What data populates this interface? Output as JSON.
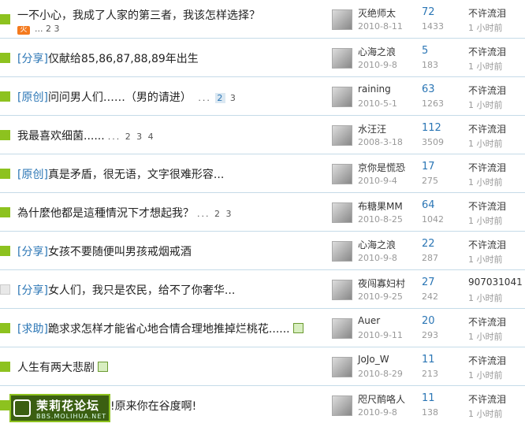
{
  "threads": [
    {
      "tag": "",
      "title": "一不小心，我成了人家的第三者，我该怎样选择？",
      "pages": "... 2 3",
      "pages_cur": "",
      "sub_fire": "火",
      "author": "灭绝师太",
      "date": "2010-8-11",
      "replies": "72",
      "views": "1433",
      "last_user": "不许流泪",
      "last_time": "1 小时前",
      "icon": "hot",
      "img": false
    },
    {
      "tag": "[分享]",
      "title": "仅献给85,86,87,88,89年出生",
      "pages": "",
      "pages_cur": "",
      "author": "心海之浪",
      "date": "2010-9-8",
      "replies": "5",
      "views": "183",
      "last_user": "不许流泪",
      "last_time": "1 小时前",
      "icon": "new",
      "img": false
    },
    {
      "tag": "[原创]",
      "title": "问问男人们……（男的请进）",
      "pages": "...",
      "pages_cur": "2",
      "pages_after": "3",
      "author": "raining",
      "date": "2010-5-1",
      "replies": "63",
      "views": "1263",
      "last_user": "不许流泪",
      "last_time": "1 小时前",
      "icon": "new",
      "img": false
    },
    {
      "tag": "",
      "title": "我最喜欢细菌......",
      "pages": "... 2 3 4",
      "pages_cur": "",
      "author": "水汪汪",
      "date": "2008-3-18",
      "replies": "112",
      "views": "3509",
      "last_user": "不许流泪",
      "last_time": "1 小时前",
      "icon": "new",
      "img": false
    },
    {
      "tag": "[原创]",
      "title": "真是矛盾，很无语，文字很难形容...",
      "pages": "",
      "pages_cur": "",
      "author": "京你是慌恐",
      "date": "2010-9-4",
      "replies": "17",
      "views": "275",
      "last_user": "不许流泪",
      "last_time": "1 小时前",
      "icon": "new",
      "img": false
    },
    {
      "tag": "",
      "title": "為什麼他都是這種情況下才想起我？",
      "pages": "... 2 3",
      "pages_cur": "",
      "author": "布糖果MM",
      "date": "2010-8-25",
      "replies": "64",
      "views": "1042",
      "last_user": "不许流泪",
      "last_time": "1 小时前",
      "icon": "new",
      "img": false
    },
    {
      "tag": "[分享]",
      "title": "女孩不要随便叫男孩戒烟戒酒",
      "pages": "",
      "pages_cur": "",
      "author": "心海之浪",
      "date": "2010-9-8",
      "replies": "22",
      "views": "287",
      "last_user": "不许流泪",
      "last_time": "1 小时前",
      "icon": "new",
      "img": false
    },
    {
      "tag": "[分享]",
      "title": "女人们，我只是农民，给不了你奢华...",
      "pages": "",
      "pages_cur": "",
      "author": "夜闯寡妇村",
      "date": "2010-9-25",
      "replies": "27",
      "views": "242",
      "last_user": "907031041",
      "last_time": "1 小时前",
      "icon": "plain",
      "img": false
    },
    {
      "tag": "[求助]",
      "title": "跪求求怎样才能省心地合情合理地推掉烂桃花......",
      "pages": "",
      "pages_cur": "",
      "author": "Auer",
      "date": "2010-9-11",
      "replies": "20",
      "views": "293",
      "last_user": "不许流泪",
      "last_time": "1 小时前",
      "icon": "new",
      "img": true
    },
    {
      "tag": "",
      "title": "人生有两大悲剧",
      "pages": "",
      "pages_cur": "",
      "author": "JoJo_W",
      "date": "2010-8-29",
      "replies": "11",
      "views": "213",
      "last_user": "不许流泪",
      "last_time": "1 小时前",
      "icon": "new",
      "img": true
    },
    {
      "tag": "",
      "title": "!原来你在谷度啊!",
      "pages": "",
      "pages_cur": "",
      "author": "咫尺鸸咯人",
      "date": "2010-9-8",
      "replies": "11",
      "views": "138",
      "last_user": "不许流泪",
      "last_time": "1 小时前",
      "icon": "new",
      "img": false
    }
  ],
  "watermark": {
    "name": "茉莉花论坛",
    "url": "BBS.MOLIHUA.NET"
  }
}
